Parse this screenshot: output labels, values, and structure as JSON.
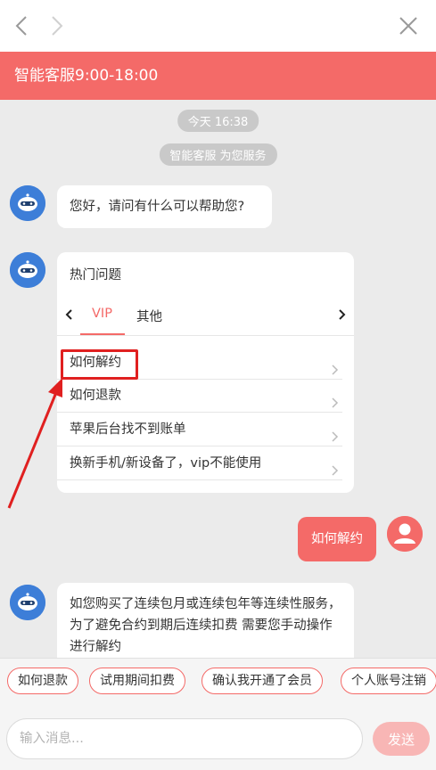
{
  "header": {
    "title": "智能客服9:00-18:00"
  },
  "chat": {
    "time_label": "今天 16:38",
    "service_label": "智能客服 为您服务",
    "greeting": "您好，请问有什么可以帮助您?",
    "hot_card": {
      "title": "热门问题",
      "tabs": [
        "VIP",
        "其他"
      ],
      "questions": [
        "如何解约",
        "如何退款",
        "苹果后台找不到账单",
        "换新手机/新设备了，vip不能使用"
      ]
    },
    "user_message": "如何解约",
    "answer": "如您购买了连续包月或连续包年等连续性服务，为了避免合约到期后连续扣费 需要您手动操作进行解约"
  },
  "quick_replies": [
    "如何退款",
    "试用期间扣费",
    "确认我开通了会员",
    "个人账号注销"
  ],
  "input": {
    "placeholder": "输入消息...",
    "send_label": "发送"
  },
  "colors": {
    "brand": "#f46a68",
    "bot_avatar": "#3d7ed8",
    "annotation": "#e02020"
  }
}
